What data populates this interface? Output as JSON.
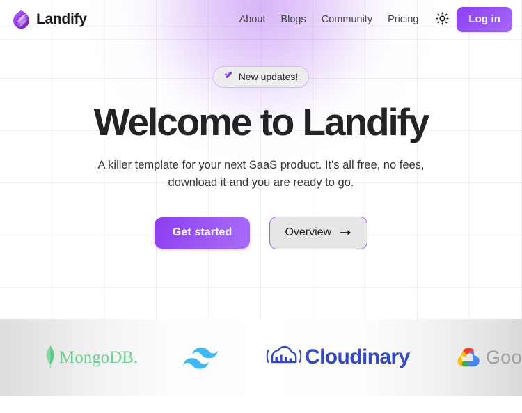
{
  "brand": {
    "name": "Landify",
    "logo_icon": "landify-flame-logo",
    "accent_color": "#8b3df0"
  },
  "header": {
    "nav_items": [
      {
        "label": "About",
        "name": "nav-link-about"
      },
      {
        "label": "Blogs",
        "name": "nav-link-blogs"
      },
      {
        "label": "Community",
        "name": "nav-link-community"
      },
      {
        "label": "Pricing",
        "name": "nav-link-pricing"
      }
    ],
    "theme_toggle_icon": "sun-icon",
    "login_label": "Log in"
  },
  "hero": {
    "badge": {
      "icon": "magic-wand-icon",
      "label": "New updates!"
    },
    "headline": "Welcome to Landify",
    "subtitle": "A killer template for your next SaaS product. It's all free, no fees, download it and you are ready to go.",
    "primary_cta": "Get started",
    "secondary_cta": "Overview",
    "secondary_cta_icon": "arrow-right-icon"
  },
  "logos": {
    "items": [
      {
        "name": "mongodb-logo",
        "label": "MongoDB.",
        "color": "#4faa72"
      },
      {
        "name": "tailwindcss-logo",
        "label": "Tailwind CSS",
        "color": "#38bdf8"
      },
      {
        "name": "cloudinary-logo",
        "label": "Cloudinary",
        "color": "#3448c5"
      },
      {
        "name": "google-cloud-logo",
        "label": "Google Cloud",
        "color": "#5f6368"
      }
    ]
  },
  "colors": {
    "primary_purple": "#8b3df0",
    "purple_light": "#a86cf8",
    "badge_border": "#d9b8f7",
    "text_dark": "#232326",
    "text_body": "#35353a",
    "grid_line": "rgba(0,0,0,0.065)"
  }
}
